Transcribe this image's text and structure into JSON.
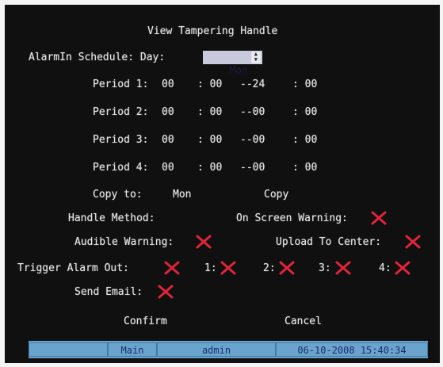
{
  "title": "View Tampering Handle",
  "schedule": {
    "label": "AlarmIn Schedule: Day:",
    "day_value": "Mon"
  },
  "periods": [
    {
      "label": "Period 1:",
      "start_h": "00",
      "start_m": ": 00",
      "end_h": "--24",
      "end_m": ": 00"
    },
    {
      "label": "Period 2:",
      "start_h": "00",
      "start_m": ": 00",
      "end_h": "--00",
      "end_m": ": 00"
    },
    {
      "label": "Period 3:",
      "start_h": "00",
      "start_m": ": 00",
      "end_h": "--00",
      "end_m": ": 00"
    },
    {
      "label": "Period 4:",
      "start_h": "00",
      "start_m": ": 00",
      "end_h": "--00",
      "end_m": ": 00"
    }
  ],
  "copy": {
    "label": "Copy to:",
    "value": "Mon",
    "button": "Copy"
  },
  "handle": {
    "method_label": "Handle Method:",
    "on_screen_warning": "On Screen Warning:",
    "audible_warning": "Audible Warning:",
    "upload_to_center": "Upload To Center:",
    "trigger_alarm_out": "Trigger Alarm Out:",
    "outputs": [
      "1:",
      "2:",
      "3:",
      "4:"
    ],
    "send_email": "Send Email:"
  },
  "buttons": {
    "confirm": "Confirm",
    "cancel": "Cancel"
  },
  "status": {
    "menu": "Main",
    "user": "admin",
    "datetime": "06-10-2008 15:40:34"
  },
  "colors": {
    "background": "#101010",
    "text": "#e2e2e2",
    "cross": "#e0243a",
    "statusbar": "#6aa3cc",
    "status_text": "#1b2f70"
  }
}
